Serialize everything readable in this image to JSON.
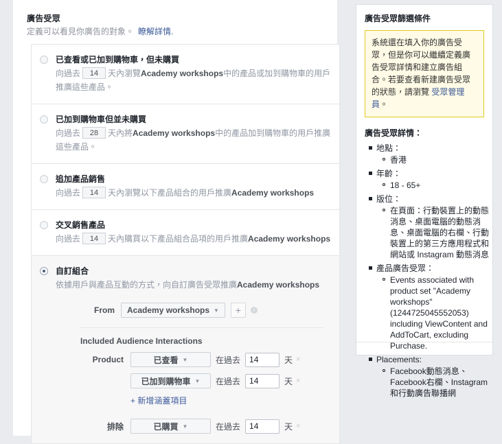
{
  "main": {
    "title": "廣告受眾",
    "subtitle": "定義可以看見你廣告的對象。",
    "learn_more": "瞭解詳情.",
    "options": [
      {
        "selected": false,
        "title": "已查看或已加到購物車，但未購買",
        "desc_pre": "向過去",
        "days": "14",
        "desc_post_a": "天內瀏覽",
        "desc_bold": "Academy workshops",
        "desc_post_b": "中的產品或加到購物車的用戶推廣這些產品。"
      },
      {
        "selected": false,
        "title": "已加到購物車但並未購買",
        "desc_pre": "向過去",
        "days": "28",
        "desc_post_a": "天內將",
        "desc_bold": "Academy workshops",
        "desc_post_b": "中的產品加到購物車的用戶推廣這些產品。"
      },
      {
        "selected": false,
        "title": "追加產品銷售",
        "desc_pre": "向過去",
        "days": "14",
        "desc_post_a": "天內瀏覽以下產品組合的用戶推廣",
        "desc_bold": "Academy workshops",
        "desc_post_b": ""
      },
      {
        "selected": false,
        "title": "交叉銷售產品",
        "desc_pre": "向過去",
        "days": "14",
        "desc_post_a": "天內購買以下產品組合品項的用戶推廣",
        "desc_bold": "Academy workshops",
        "desc_post_b": ""
      }
    ],
    "custom": {
      "selected": true,
      "title": "自訂組合",
      "desc_a": "依據用戶與產品互動的方式，向自訂廣告受眾推廣",
      "desc_bold": "Academy workshops",
      "from_label": "From",
      "from_value": "Academy workshops",
      "plus_label": "+",
      "included_heading": "Included Audience Interactions",
      "product_label": "Product",
      "rows": [
        {
          "event": "已查看",
          "between": "在過去",
          "days": "14",
          "unit": "天"
        },
        {
          "event": "已加到購物車",
          "between": "在過去",
          "days": "14",
          "unit": "天"
        }
      ],
      "add_link": "+ 新增涵蓋項目",
      "exclude_label": "排除",
      "exclude_rows": [
        {
          "event": "已購買",
          "between": "在過去",
          "days": "14",
          "unit": "天"
        }
      ]
    }
  },
  "sidebar": {
    "title": "廣告受眾篩選條件",
    "callout": {
      "text_a": "系統還在填入你的廣告受眾，但是你可以繼續定義廣告受眾詳情和建立廣告組合。若要查看新建廣告受眾的狀態，請瀏覽 ",
      "link": "受眾管理員",
      "text_b": "。"
    },
    "details_heading": "廣告受眾詳情：",
    "details": [
      {
        "label": "地點：",
        "items": [
          "香港"
        ]
      },
      {
        "label": "年齡：",
        "items": [
          "18 - 65+"
        ]
      },
      {
        "label": "版位：",
        "items": [
          "在頁面：行動裝置上的動態消息、桌面電腦的動態消息、桌面電腦的右欄、行動裝置上的第三方應用程式和網站或 Instagram 動態消息"
        ]
      },
      {
        "label": "產品廣告受眾：",
        "items": [
          "Events associated with product set \"Academy workshops\" (1244725045552053) including ViewContent and AddToCart, excluding Purchase."
        ]
      },
      {
        "label": "Placements:",
        "items": [
          "Facebook動態消息、Facebook右欄、Instagram 和行動廣告聯播網"
        ]
      }
    ]
  },
  "colors": {
    "page_bg": "#e9ebee",
    "link": "#3b5998",
    "callout_border": "#e2c822",
    "callout_bg": "#fffbe6"
  }
}
